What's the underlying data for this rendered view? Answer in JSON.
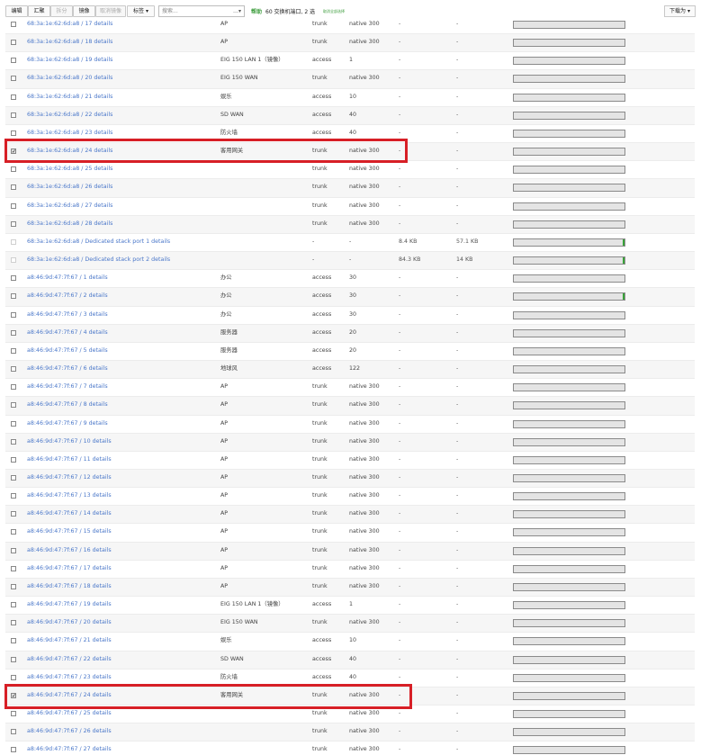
{
  "toolbar": {
    "buttons": [
      "编辑",
      "汇聚",
      "拆分",
      "镜像",
      "取消镜像",
      "标签 ▾"
    ],
    "search_placeholder": "搜索...",
    "help": "帮助",
    "count": "60 交换机端口, 2 选",
    "clear": "取消全部选择",
    "download": "下载为 ▾"
  },
  "rows": [
    {
      "checked": false,
      "disabled": false,
      "port": "68:3a:1e:62:6d:a8 / 17",
      "details": "details",
      "name": "AP",
      "mode": "trunk",
      "vlan": "native 300",
      "rx": "-",
      "tx": "-",
      "fill": false
    },
    {
      "checked": false,
      "disabled": false,
      "port": "68:3a:1e:62:6d:a8 / 18",
      "details": "details",
      "name": "AP",
      "mode": "trunk",
      "vlan": "native 300",
      "rx": "-",
      "tx": "-",
      "fill": false
    },
    {
      "checked": false,
      "disabled": false,
      "port": "68:3a:1e:62:6d:a8 / 19",
      "details": "details",
      "name": "EIG 150 LAN 1（镜像）",
      "mode": "access",
      "vlan": "1",
      "rx": "-",
      "tx": "-",
      "fill": false
    },
    {
      "checked": false,
      "disabled": false,
      "port": "68:3a:1e:62:6d:a8 / 20",
      "details": "details",
      "name": "EIG 150 WAN",
      "mode": "trunk",
      "vlan": "native 300",
      "rx": "-",
      "tx": "-",
      "fill": false
    },
    {
      "checked": false,
      "disabled": false,
      "port": "68:3a:1e:62:6d:a8 / 21",
      "details": "details",
      "name": "娱乐",
      "mode": "access",
      "vlan": "10",
      "rx": "-",
      "tx": "-",
      "fill": false
    },
    {
      "checked": false,
      "disabled": false,
      "port": "68:3a:1e:62:6d:a8 / 22",
      "details": "details",
      "name": "SD WAN",
      "mode": "access",
      "vlan": "40",
      "rx": "-",
      "tx": "-",
      "fill": false
    },
    {
      "checked": false,
      "disabled": false,
      "port": "68:3a:1e:62:6d:a8 / 23",
      "details": "details",
      "name": "防火墙",
      "mode": "access",
      "vlan": "40",
      "rx": "-",
      "tx": "-",
      "fill": false
    },
    {
      "checked": true,
      "disabled": false,
      "port": "68:3a:1e:62:6d:a8 / 24",
      "details": "details",
      "name": "客用网关",
      "mode": "trunk",
      "vlan": "native 300",
      "rx": "-",
      "tx": "-",
      "fill": false
    },
    {
      "checked": false,
      "disabled": false,
      "port": "68:3a:1e:62:6d:a8 / 25",
      "details": "details",
      "name": "",
      "mode": "trunk",
      "vlan": "native 300",
      "rx": "-",
      "tx": "-",
      "fill": false
    },
    {
      "checked": false,
      "disabled": false,
      "port": "68:3a:1e:62:6d:a8 / 26",
      "details": "details",
      "name": "",
      "mode": "trunk",
      "vlan": "native 300",
      "rx": "-",
      "tx": "-",
      "fill": false
    },
    {
      "checked": false,
      "disabled": false,
      "port": "68:3a:1e:62:6d:a8 / 27",
      "details": "details",
      "name": "",
      "mode": "trunk",
      "vlan": "native 300",
      "rx": "-",
      "tx": "-",
      "fill": false
    },
    {
      "checked": false,
      "disabled": false,
      "port": "68:3a:1e:62:6d:a8 / 28",
      "details": "details",
      "name": "",
      "mode": "trunk",
      "vlan": "native 300",
      "rx": "-",
      "tx": "-",
      "fill": false
    },
    {
      "checked": false,
      "disabled": true,
      "port": "68:3a:1e:62:6d:a8 / Dedicated stack port 1",
      "details": "details",
      "name": "",
      "mode": "-",
      "vlan": "-",
      "rx": "8.4 KB",
      "tx": "57.1 KB",
      "fill": true
    },
    {
      "checked": false,
      "disabled": true,
      "port": "68:3a:1e:62:6d:a8 / Dedicated stack port 2",
      "details": "details",
      "name": "",
      "mode": "-",
      "vlan": "-",
      "rx": "84.3 KB",
      "tx": "14 KB",
      "fill": true
    },
    {
      "checked": false,
      "disabled": false,
      "port": "a8:46:9d:47:7f:67 / 1",
      "details": "details",
      "name": "办公",
      "mode": "access",
      "vlan": "30",
      "rx": "-",
      "tx": "-",
      "fill": false
    },
    {
      "checked": false,
      "disabled": false,
      "port": "a8:46:9d:47:7f:67 / 2",
      "details": "details",
      "name": "办公",
      "mode": "access",
      "vlan": "30",
      "rx": "-",
      "tx": "-",
      "fill": true
    },
    {
      "checked": false,
      "disabled": false,
      "port": "a8:46:9d:47:7f:67 / 3",
      "details": "details",
      "name": "办公",
      "mode": "access",
      "vlan": "30",
      "rx": "-",
      "tx": "-",
      "fill": false
    },
    {
      "checked": false,
      "disabled": false,
      "port": "a8:46:9d:47:7f:67 / 4",
      "details": "details",
      "name": "服务器",
      "mode": "access",
      "vlan": "20",
      "rx": "-",
      "tx": "-",
      "fill": false
    },
    {
      "checked": false,
      "disabled": false,
      "port": "a8:46:9d:47:7f:67 / 5",
      "details": "details",
      "name": "服务器",
      "mode": "access",
      "vlan": "20",
      "rx": "-",
      "tx": "-",
      "fill": false
    },
    {
      "checked": false,
      "disabled": false,
      "port": "a8:46:9d:47:7f:67 / 6",
      "details": "details",
      "name": "地球风",
      "mode": "access",
      "vlan": "122",
      "rx": "-",
      "tx": "-",
      "fill": false
    },
    {
      "checked": false,
      "disabled": false,
      "port": "a8:46:9d:47:7f:67 / 7",
      "details": "details",
      "name": "AP",
      "mode": "trunk",
      "vlan": "native 300",
      "rx": "-",
      "tx": "-",
      "fill": false
    },
    {
      "checked": false,
      "disabled": false,
      "port": "a8:46:9d:47:7f:67 / 8",
      "details": "details",
      "name": "AP",
      "mode": "trunk",
      "vlan": "native 300",
      "rx": "-",
      "tx": "-",
      "fill": false
    },
    {
      "checked": false,
      "disabled": false,
      "port": "a8:46:9d:47:7f:67 / 9",
      "details": "details",
      "name": "AP",
      "mode": "trunk",
      "vlan": "native 300",
      "rx": "-",
      "tx": "-",
      "fill": false
    },
    {
      "checked": false,
      "disabled": false,
      "port": "a8:46:9d:47:7f:67 / 10",
      "details": "details",
      "name": "AP",
      "mode": "trunk",
      "vlan": "native 300",
      "rx": "-",
      "tx": "-",
      "fill": false
    },
    {
      "checked": false,
      "disabled": false,
      "port": "a8:46:9d:47:7f:67 / 11",
      "details": "details",
      "name": "AP",
      "mode": "trunk",
      "vlan": "native 300",
      "rx": "-",
      "tx": "-",
      "fill": false
    },
    {
      "checked": false,
      "disabled": false,
      "port": "a8:46:9d:47:7f:67 / 12",
      "details": "details",
      "name": "AP",
      "mode": "trunk",
      "vlan": "native 300",
      "rx": "-",
      "tx": "-",
      "fill": false
    },
    {
      "checked": false,
      "disabled": false,
      "port": "a8:46:9d:47:7f:67 / 13",
      "details": "details",
      "name": "AP",
      "mode": "trunk",
      "vlan": "native 300",
      "rx": "-",
      "tx": "-",
      "fill": false
    },
    {
      "checked": false,
      "disabled": false,
      "port": "a8:46:9d:47:7f:67 / 14",
      "details": "details",
      "name": "AP",
      "mode": "trunk",
      "vlan": "native 300",
      "rx": "-",
      "tx": "-",
      "fill": false
    },
    {
      "checked": false,
      "disabled": false,
      "port": "a8:46:9d:47:7f:67 / 15",
      "details": "details",
      "name": "AP",
      "mode": "trunk",
      "vlan": "native 300",
      "rx": "-",
      "tx": "-",
      "fill": false
    },
    {
      "checked": false,
      "disabled": false,
      "port": "a8:46:9d:47:7f:67 / 16",
      "details": "details",
      "name": "AP",
      "mode": "trunk",
      "vlan": "native 300",
      "rx": "-",
      "tx": "-",
      "fill": false
    },
    {
      "checked": false,
      "disabled": false,
      "port": "a8:46:9d:47:7f:67 / 17",
      "details": "details",
      "name": "AP",
      "mode": "trunk",
      "vlan": "native 300",
      "rx": "-",
      "tx": "-",
      "fill": false
    },
    {
      "checked": false,
      "disabled": false,
      "port": "a8:46:9d:47:7f:67 / 18",
      "details": "details",
      "name": "AP",
      "mode": "trunk",
      "vlan": "native 300",
      "rx": "-",
      "tx": "-",
      "fill": false
    },
    {
      "checked": false,
      "disabled": false,
      "port": "a8:46:9d:47:7f:67 / 19",
      "details": "details",
      "name": "EIG 150 LAN 1（镜像）",
      "mode": "access",
      "vlan": "1",
      "rx": "-",
      "tx": "-",
      "fill": false
    },
    {
      "checked": false,
      "disabled": false,
      "port": "a8:46:9d:47:7f:67 / 20",
      "details": "details",
      "name": "EIG 150 WAN",
      "mode": "trunk",
      "vlan": "native 300",
      "rx": "-",
      "tx": "-",
      "fill": false
    },
    {
      "checked": false,
      "disabled": false,
      "port": "a8:46:9d:47:7f:67 / 21",
      "details": "details",
      "name": "娱乐",
      "mode": "access",
      "vlan": "10",
      "rx": "-",
      "tx": "-",
      "fill": false
    },
    {
      "checked": false,
      "disabled": false,
      "port": "a8:46:9d:47:7f:67 / 22",
      "details": "details",
      "name": "SD WAN",
      "mode": "access",
      "vlan": "40",
      "rx": "-",
      "tx": "-",
      "fill": false
    },
    {
      "checked": false,
      "disabled": false,
      "port": "a8:46:9d:47:7f:67 / 23",
      "details": "details",
      "name": "防火墙",
      "mode": "access",
      "vlan": "40",
      "rx": "-",
      "tx": "-",
      "fill": false
    },
    {
      "checked": true,
      "disabled": false,
      "port": "a8:46:9d:47:7f:67 / 24",
      "details": "details",
      "name": "客用网关",
      "mode": "trunk",
      "vlan": "native 300",
      "rx": "-",
      "tx": "-",
      "fill": false
    },
    {
      "checked": false,
      "disabled": false,
      "port": "a8:46:9d:47:7f:67 / 25",
      "details": "details",
      "name": "",
      "mode": "trunk",
      "vlan": "native 300",
      "rx": "-",
      "tx": "-",
      "fill": false
    },
    {
      "checked": false,
      "disabled": false,
      "port": "a8:46:9d:47:7f:67 / 26",
      "details": "details",
      "name": "",
      "mode": "trunk",
      "vlan": "native 300",
      "rx": "-",
      "tx": "-",
      "fill": false
    },
    {
      "checked": false,
      "disabled": false,
      "port": "a8:46:9d:47:7f:67 / 27",
      "details": "details",
      "name": "",
      "mode": "trunk",
      "vlan": "native 300",
      "rx": "-",
      "tx": "-",
      "fill": false
    }
  ],
  "colors": {
    "link": "#4a77c9",
    "highlight": "#d71f26",
    "usage_fill": "#3aa33a",
    "help": "#3a9b3a"
  }
}
